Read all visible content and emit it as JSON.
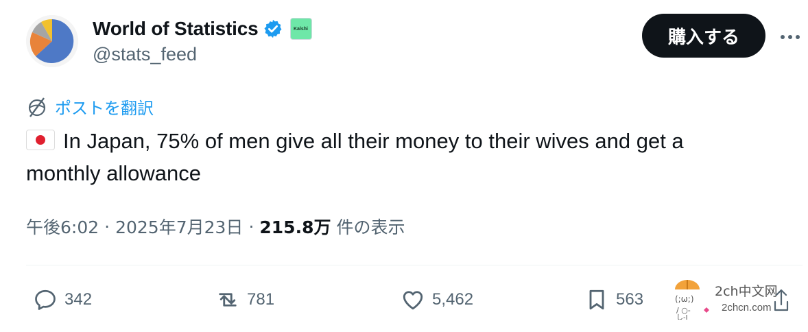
{
  "author": {
    "display_name": "World of Statistics",
    "handle": "@stats_feed",
    "affiliate_badge": "Kalshi",
    "verified_color": "#1d9bf0"
  },
  "header": {
    "buy_button_label": "購入する",
    "more_icon": "more-horizontal-icon"
  },
  "translate": {
    "label": "ポストを翻訳"
  },
  "tweet": {
    "flag": "japan-flag",
    "text_line1": "In Japan, 75% of men give all their money to their wives and get a",
    "text_line2": "monthly allowance"
  },
  "meta": {
    "time": "午後6:02",
    "sep1": "·",
    "date": "2025年7月23日",
    "sep2": "·",
    "views": "215.8万",
    "views_label": "件の表示"
  },
  "actions": {
    "replies": "342",
    "reposts": "781",
    "likes": "5,462",
    "bookmarks": "563"
  },
  "watermark": {
    "line1": "2ch中文网",
    "line2": "2chcn.com"
  }
}
